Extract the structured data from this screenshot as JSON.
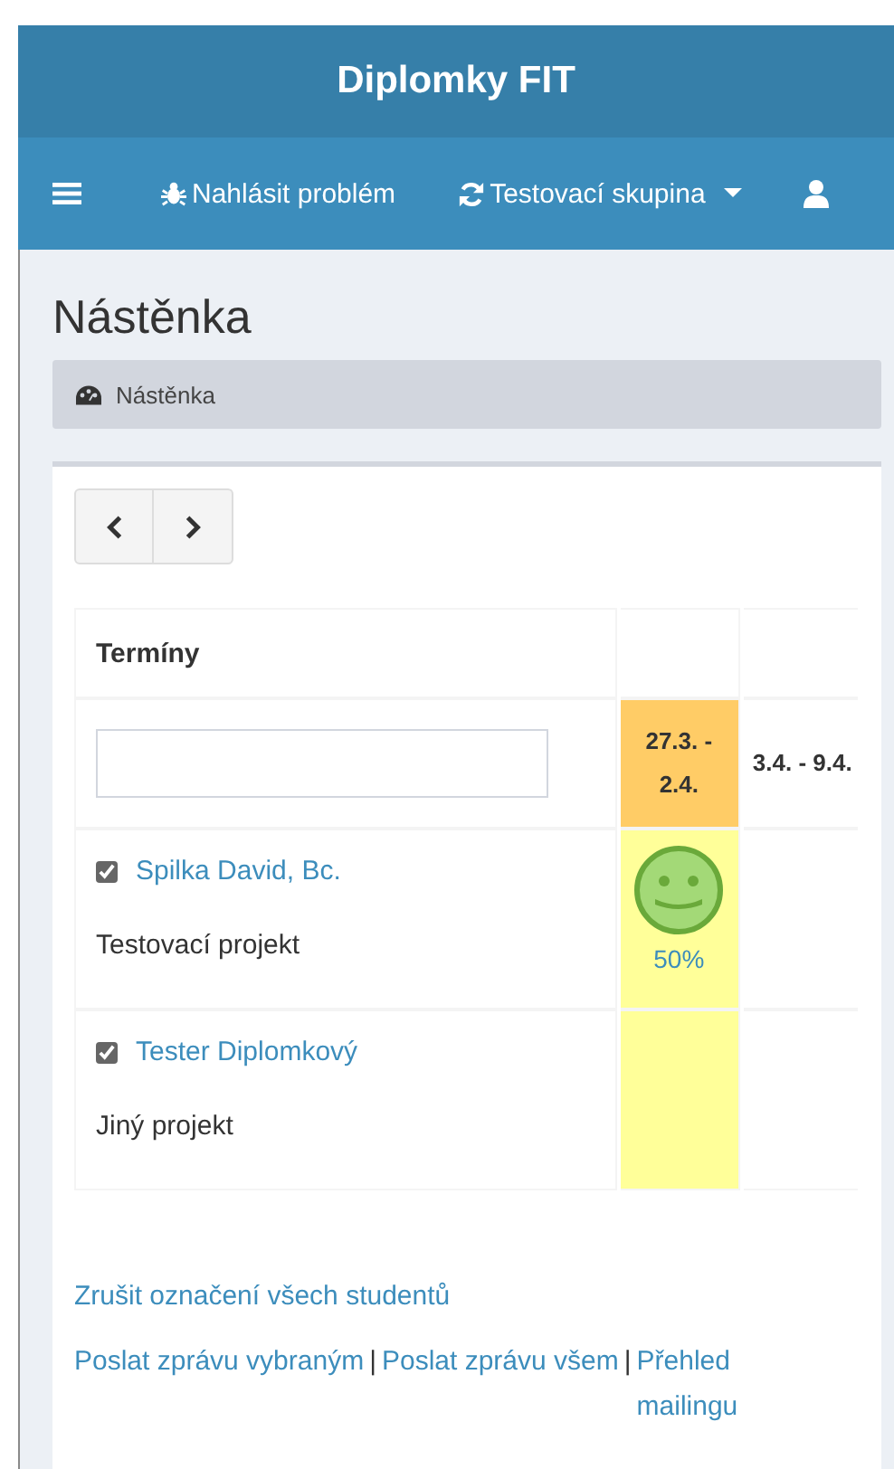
{
  "header": {
    "title": "Diplomky FIT"
  },
  "nav": {
    "items": [
      {
        "kind": "bug",
        "label": "Nahlásit problém",
        "dropdown": false
      },
      {
        "kind": "refresh",
        "label": "Testovací skupina",
        "dropdown": true
      }
    ]
  },
  "page": {
    "title": "Nástěnka",
    "breadcrumb": "Nástěnka"
  },
  "table": {
    "heading": "Termíny",
    "weeks": [
      {
        "label": "27.3. - 2.4.",
        "current": true
      },
      {
        "label": "3.4. - 9.4.",
        "current": false
      }
    ],
    "students": [
      {
        "name": "Spilka David, Bc.",
        "project": "Testovací projekt",
        "checked": true,
        "cells": [
          {
            "kind": "smiley",
            "reading": "50%",
            "highlighted": true
          },
          {
            "kind": "empty",
            "highlighted": false
          }
        ]
      },
      {
        "name": "Tester Diplomkový",
        "project": "Jiný projekt",
        "checked": true,
        "cells": [
          {
            "kind": "empty",
            "highlighted": true
          },
          {
            "kind": "empty",
            "highlighted": false
          }
        ]
      }
    ]
  },
  "links": {
    "unselect": "Zrušit označení všech studentů",
    "separator": "|",
    "mail": [
      "Poslat zprávu vybraným",
      "Poslat zprávu všem",
      "Přehled mailingu"
    ]
  }
}
